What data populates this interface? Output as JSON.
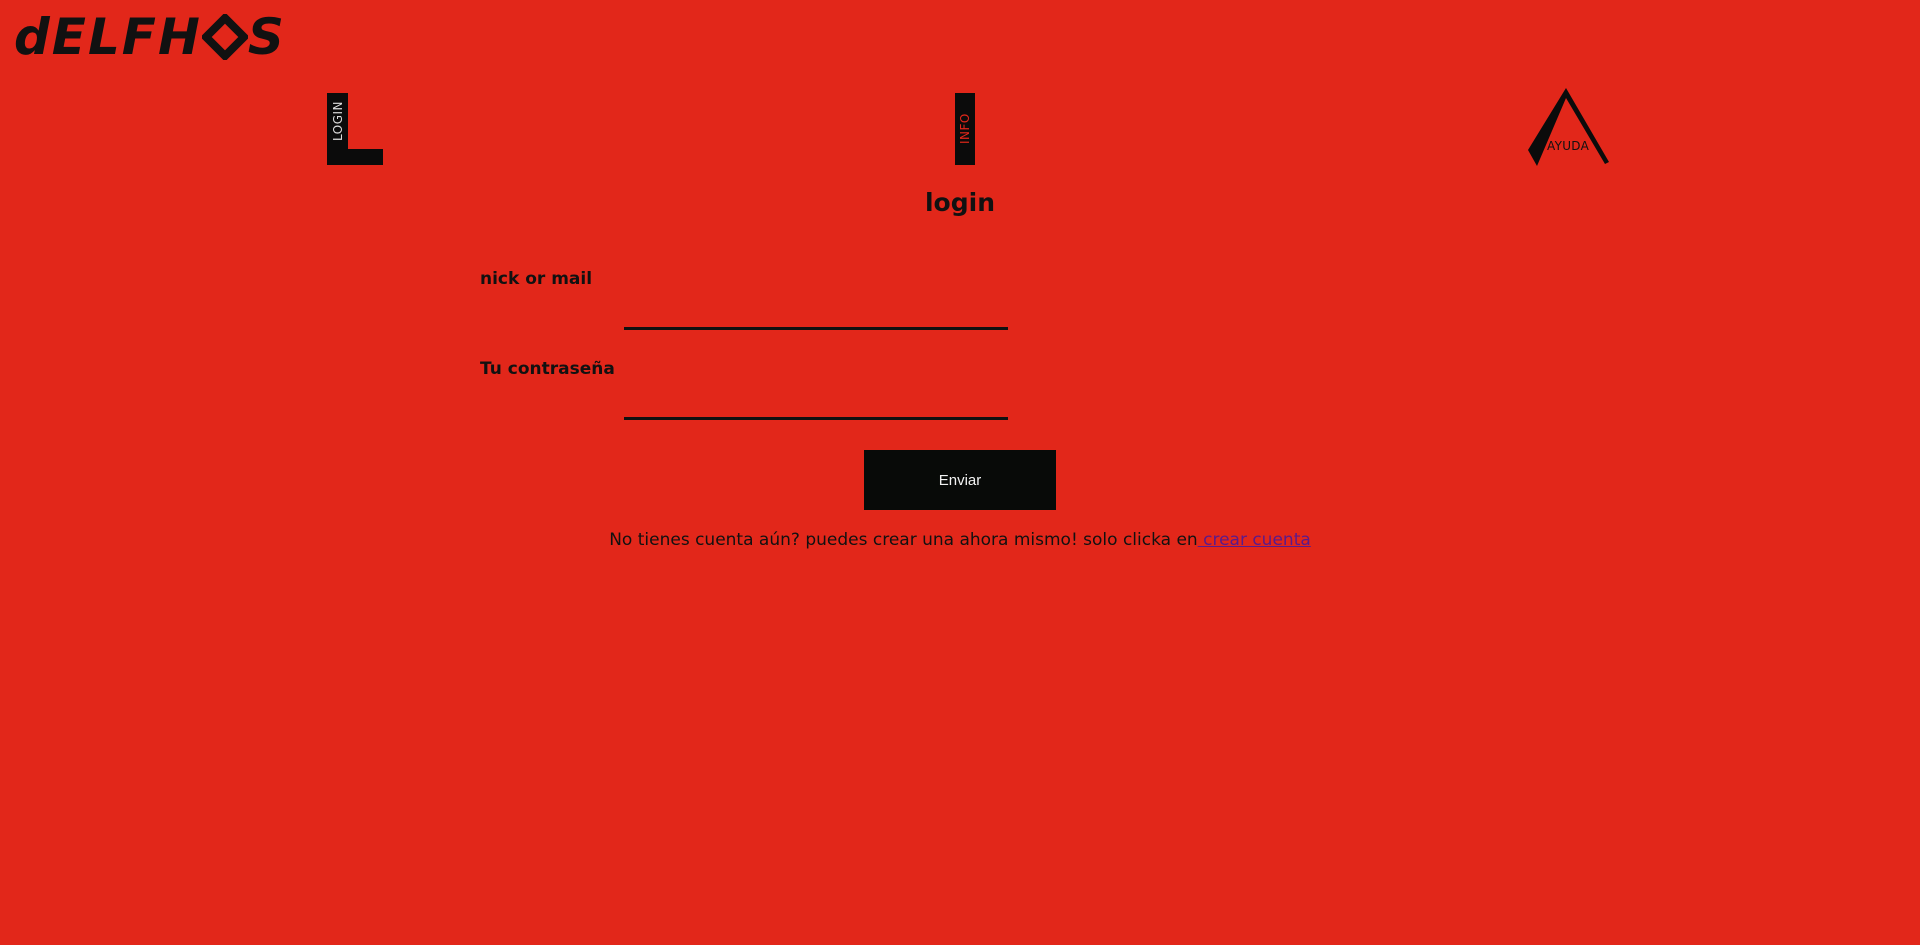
{
  "brand": {
    "logo_text": "dELFHOS"
  },
  "nav": {
    "login_label": "LOGIN",
    "info_label": "INFO",
    "ayuda_label": "AYUDA"
  },
  "main": {
    "title": "login",
    "form": {
      "nick_label": "nick or mail",
      "nick_value": "",
      "password_label": "Tu contraseña",
      "password_value": "",
      "submit_label": "Enviar"
    },
    "signup": {
      "text": "No tienes cuenta aún? puedes crear una ahora mismo! solo clicka en",
      "link_text": " crear cuenta"
    }
  },
  "colors": {
    "background": "#e2271a",
    "foreground": "#111111",
    "button_bg": "#080a08",
    "link": "#5a1a8c"
  }
}
